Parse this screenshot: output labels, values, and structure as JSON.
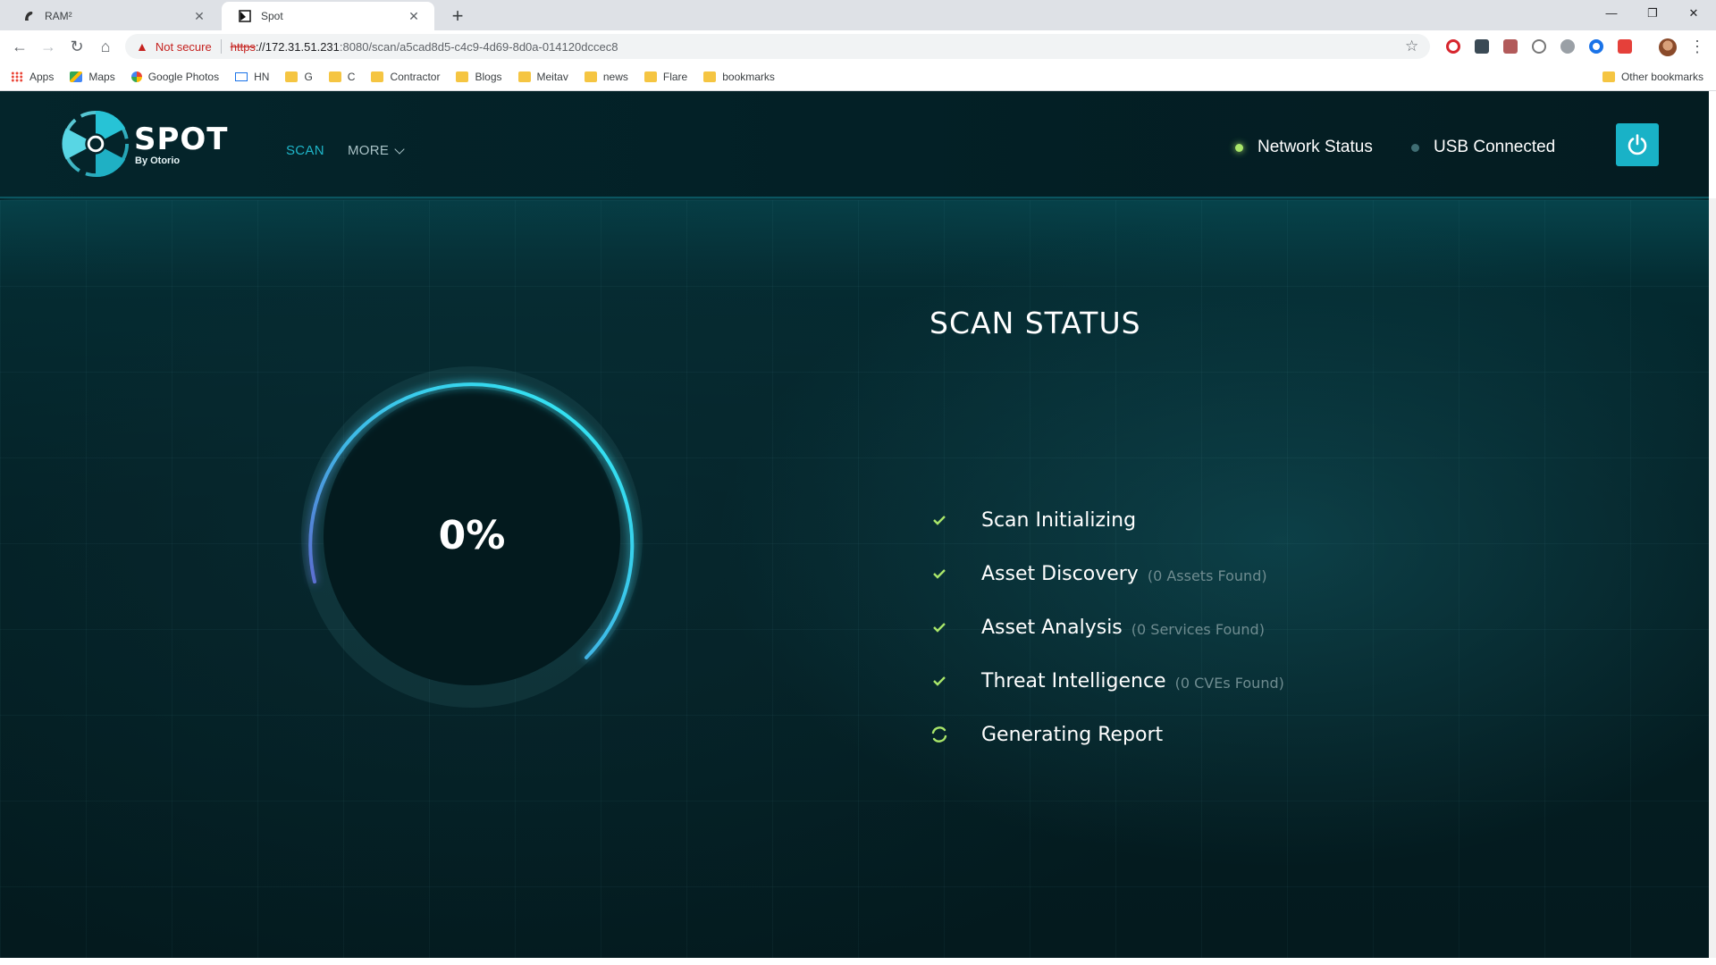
{
  "browser": {
    "tabs": [
      {
        "title": "RAM²",
        "favicon": "ram-icon",
        "active": false
      },
      {
        "title": "Spot",
        "favicon": "spot-icon",
        "active": true
      }
    ],
    "new_tab_label": "+",
    "address": {
      "security_label": "Not secure",
      "scheme": "https",
      "host": "://172.31.51.231",
      "path": ":8080/scan/a5cad8d5-c4c9-4d69-8d0a-014120dccec8"
    },
    "bookmarks": [
      {
        "label": "Apps",
        "icon": "apps-grid-icon"
      },
      {
        "label": "Maps",
        "icon": "maps-icon"
      },
      {
        "label": "Google Photos",
        "icon": "photos-icon"
      },
      {
        "label": "HN",
        "icon": "mail-icon"
      },
      {
        "label": "G",
        "icon": "folder-icon"
      },
      {
        "label": "C",
        "icon": "folder-icon"
      },
      {
        "label": "Contractor",
        "icon": "folder-icon"
      },
      {
        "label": "Blogs",
        "icon": "folder-icon"
      },
      {
        "label": "Meitav",
        "icon": "folder-icon"
      },
      {
        "label": "news",
        "icon": "folder-icon"
      },
      {
        "label": "Flare",
        "icon": "folder-icon"
      },
      {
        "label": "bookmarks",
        "icon": "folder-icon"
      }
    ],
    "other_bookmarks": "Other bookmarks"
  },
  "app": {
    "brand": "SPOT",
    "brand_sub": "By Otorio",
    "nav": {
      "scan": "SCAN",
      "more": "MORE"
    },
    "status": {
      "network": "Network Status",
      "usb": "USB Connected"
    },
    "colors": {
      "accent": "#19b2c7",
      "ok": "#a9e66a",
      "background": "#041c20"
    }
  },
  "scan": {
    "progress_text": "0%",
    "progress_value": 0,
    "title": "SCAN STATUS",
    "steps": [
      {
        "label": "Scan Initializing",
        "note": "",
        "state": "done"
      },
      {
        "label": "Asset Discovery",
        "note": "(0 Assets Found)",
        "state": "done"
      },
      {
        "label": "Asset Analysis",
        "note": "(0 Services Found)",
        "state": "done"
      },
      {
        "label": "Threat Intelligence",
        "note": "(0 CVEs Found)",
        "state": "done"
      },
      {
        "label": "Generating Report",
        "note": "",
        "state": "in-progress"
      }
    ]
  }
}
